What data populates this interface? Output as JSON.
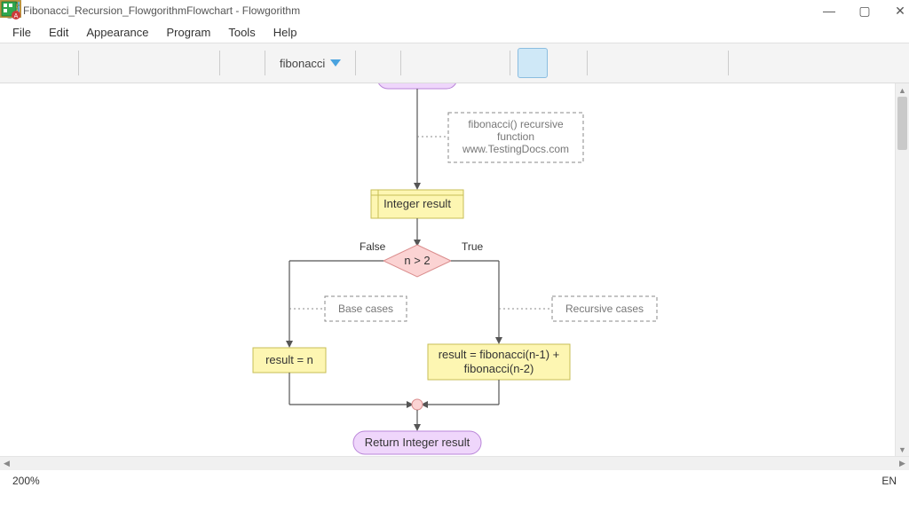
{
  "window": {
    "title": "Fibonacci_Recursion_FlowgorithmFlowchart - Flowgorithm"
  },
  "menu": {
    "file": "File",
    "edit": "Edit",
    "appearance": "Appearance",
    "program": "Program",
    "tools": "Tools",
    "help": "Help"
  },
  "toolbar": {
    "function": "fibonacci"
  },
  "flow": {
    "comment1_l1": "fibonacci() recursive",
    "comment1_l2": "function",
    "comment1_l3": "www.TestingDocs.com",
    "declare": "Integer result",
    "cond": "n > 2",
    "false_label": "False",
    "true_label": "True",
    "comment_left": "Base cases",
    "comment_right": "Recursive cases",
    "assign_left": "result = n",
    "assign_right_l1": "result = fibonacci(n-1) +",
    "assign_right_l2": "fibonacci(n-2)",
    "return": "Return Integer result"
  },
  "status": {
    "zoom": "200%",
    "lang": "EN"
  },
  "colors": {
    "yellow": "#fdf6b2",
    "pink": "#fbd3d3",
    "purple": "#efd6fb"
  }
}
